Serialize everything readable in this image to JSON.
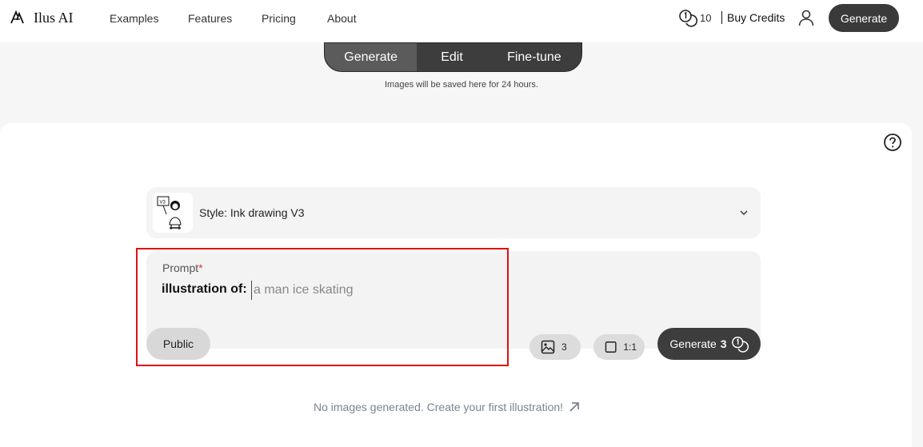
{
  "brand": {
    "name": "Ilus AI",
    "logo_icon": "ilus-logo-icon"
  },
  "nav": {
    "links": [
      "Examples",
      "Features",
      "Pricing",
      "About"
    ],
    "credits_count": "10",
    "buy_credits": "Buy Credits",
    "generate_label": "Generate"
  },
  "modes": {
    "tabs": [
      "Generate",
      "Edit",
      "Fine-tune"
    ],
    "active": "Generate",
    "note": "Images will be saved here for 24 hours."
  },
  "style": {
    "label": "Style: Ink drawing V3",
    "thumb_badge": "V3"
  },
  "prompt": {
    "label": "Prompt",
    "required_mark": "*",
    "prefix": "illustration of:",
    "placeholder": "a man ice skating",
    "value": ""
  },
  "controls": {
    "public_label": "Public",
    "image_count": "3",
    "aspect_ratio": "1:1",
    "generate_label": "Generate",
    "generate_count": "3"
  },
  "empty_state": "No images generated. Create your first illustration!",
  "colors": {
    "accent_dark": "#3d3d3d",
    "highlight": "#e01010"
  }
}
